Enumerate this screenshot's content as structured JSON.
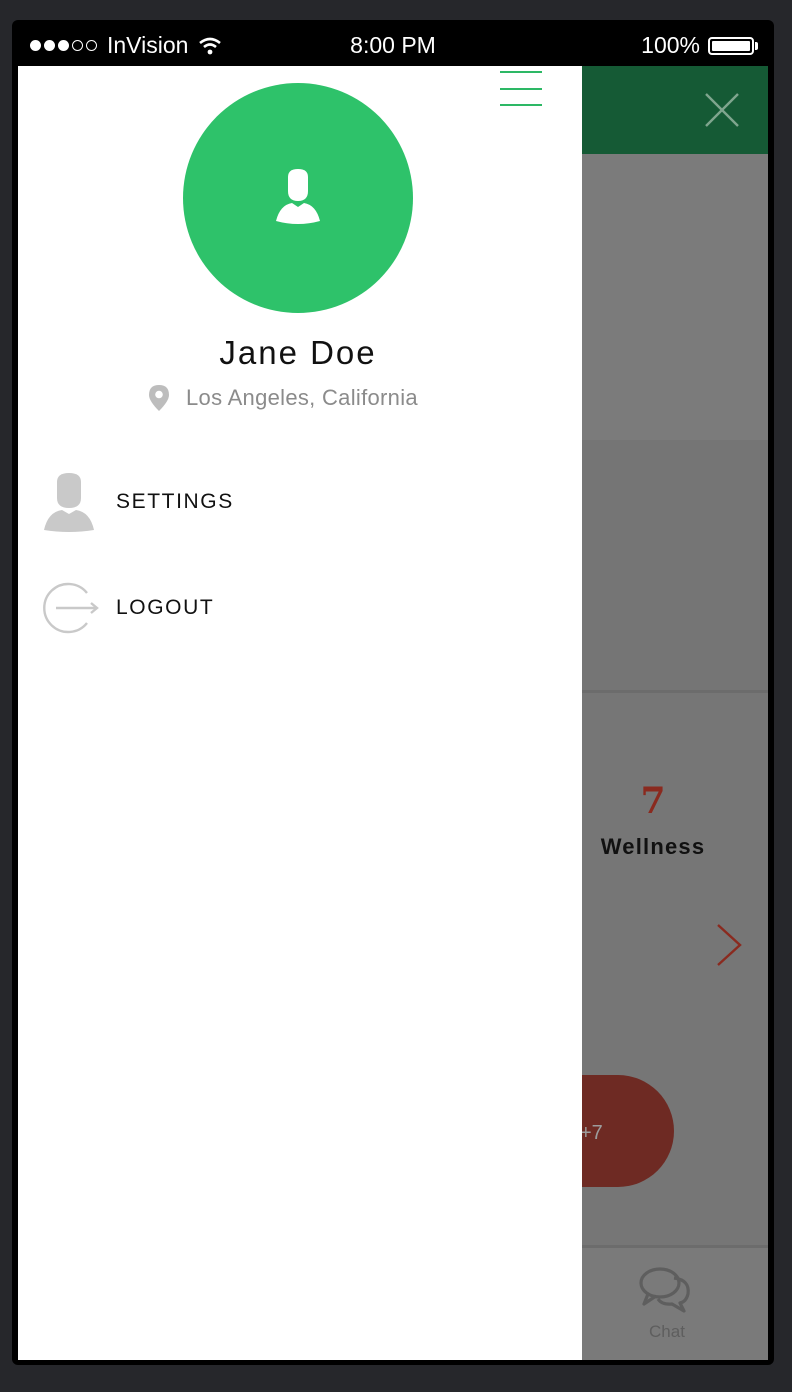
{
  "status_bar": {
    "carrier": "InVision",
    "time": "8:00 PM",
    "battery": "100%",
    "signal_icon": "signal-dots-icon",
    "wifi_icon": "wifi-icon",
    "battery_icon": "battery-icon"
  },
  "drawer": {
    "menu_icon": "hamburger-icon",
    "avatar_icon": "user-silhouette-icon",
    "user_name": "Jane Doe",
    "location_icon": "map-pin-icon",
    "location": "Los Angeles, California",
    "items": [
      {
        "label": "SETTINGS",
        "icon": "user-silhouette-icon"
      },
      {
        "label": "LOGOUT",
        "icon": "logout-icon"
      }
    ]
  },
  "background_screen": {
    "close_icon": "close-icon",
    "stat_value": "7",
    "stat_label": "Wellness",
    "next_icon": "chevron-right-icon",
    "pill_label": "+7",
    "tab_chat_label": "Chat",
    "tab_chat_icon": "chat-bubbles-icon"
  },
  "colors": {
    "accent_green": "#2ec26a",
    "header_green": "#155a35",
    "wellness_red": "#8a2a1f"
  }
}
